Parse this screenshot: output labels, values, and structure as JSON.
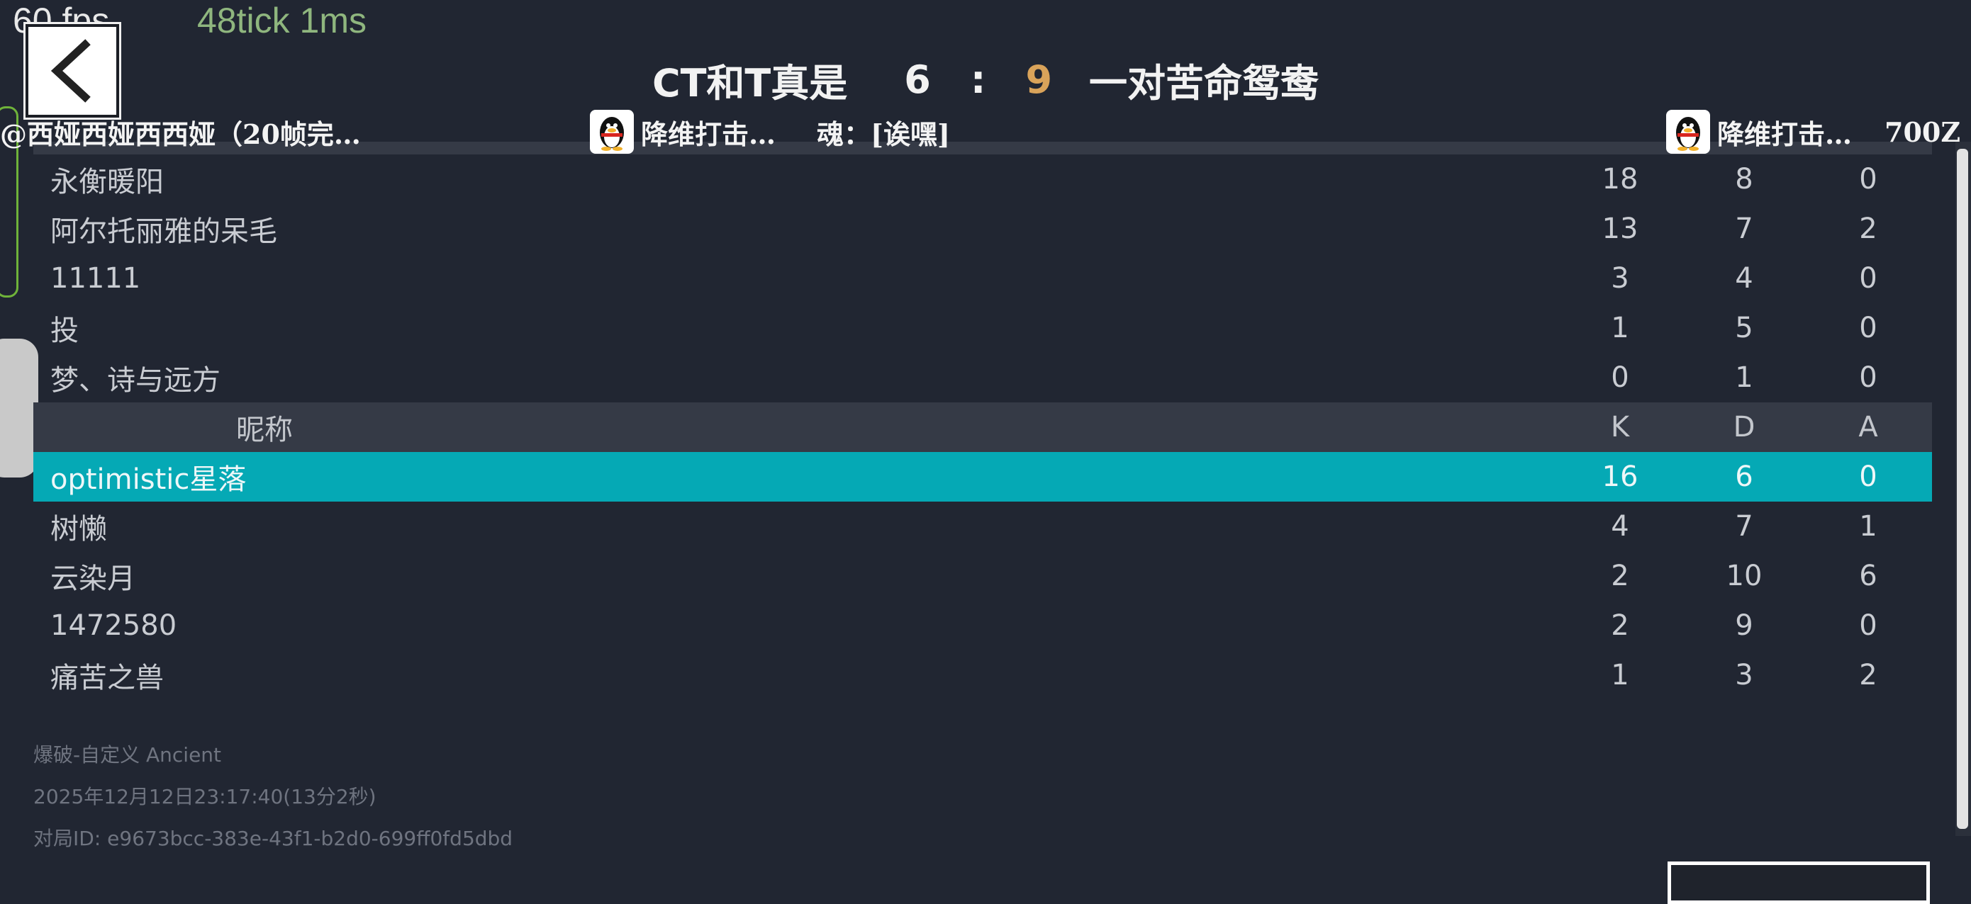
{
  "overlay": {
    "fps": "60 fps",
    "tick": "48tick 1ms"
  },
  "match": {
    "team_ct": "CT和T真是",
    "score_ct": "6",
    "score_sep": ":",
    "score_t": "9",
    "team_t": "一对苦命鸳鸯"
  },
  "strip": {
    "left_player": "@西娅西娅西西娅（20帧完…",
    "middle_player": "降维打击…",
    "middle_tag": "魂：[诶嘿]",
    "right_player": "降维打击…",
    "right_tag": "700Z"
  },
  "team_top": [
    {
      "name": "永衡暖阳",
      "k": "18",
      "d": "8",
      "a": "0"
    },
    {
      "name": "阿尔托丽雅的呆毛",
      "k": "13",
      "d": "7",
      "a": "2"
    },
    {
      "name": "11111",
      "k": "3",
      "d": "4",
      "a": "0"
    },
    {
      "name": "投",
      "k": "1",
      "d": "5",
      "a": "0"
    },
    {
      "name": "梦、诗与远方",
      "k": "0",
      "d": "1",
      "a": "0"
    }
  ],
  "header": {
    "name": "昵称",
    "k": "K",
    "d": "D",
    "a": "A"
  },
  "team_bottom": [
    {
      "name": "optimistic星落",
      "k": "16",
      "d": "6",
      "a": "0"
    },
    {
      "name": "树懒",
      "k": "4",
      "d": "7",
      "a": "1"
    },
    {
      "name": "云染月",
      "k": "2",
      "d": "10",
      "a": "6"
    },
    {
      "name": "1472580",
      "k": "2",
      "d": "9",
      "a": "0"
    },
    {
      "name": "痛苦之兽",
      "k": "1",
      "d": "3",
      "a": "2"
    }
  ],
  "meta": {
    "mode": "爆破-自定义 Ancient",
    "time": "2025年12月12日23:17:40(13分2秒)",
    "match_id": "对局ID: e9673bcc-383e-43f1-b2d0-699ff0fd5dbd"
  },
  "colors": {
    "highlight": "#05a9b5",
    "score_t": "#d9a35a",
    "fps_tick": "#8fb67e"
  }
}
